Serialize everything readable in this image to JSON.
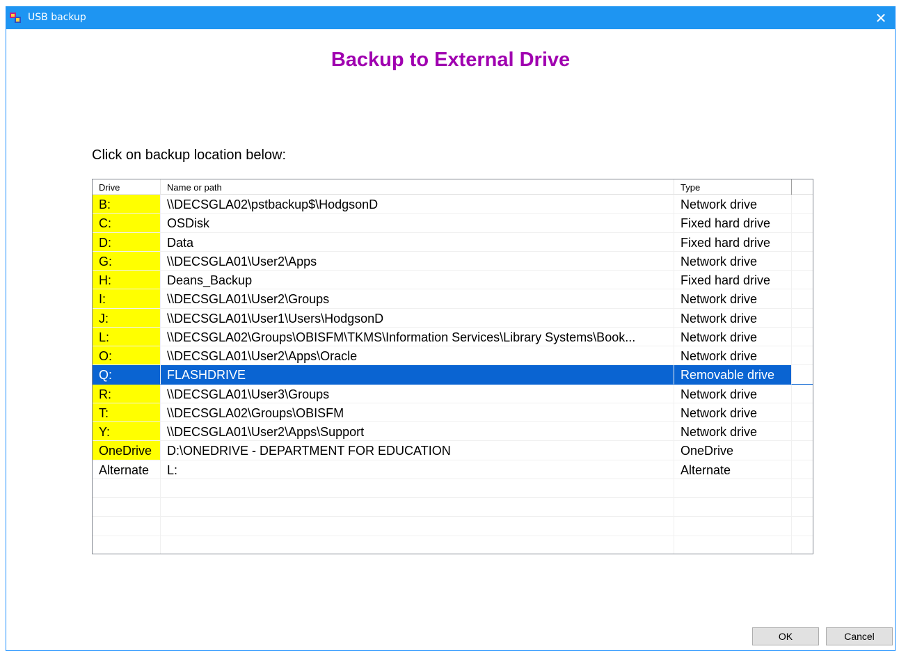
{
  "window": {
    "title": "USB backup",
    "close_glyph": "✕"
  },
  "heading": "Backup to External Drive",
  "prompt": "Click on backup location below:",
  "list": {
    "columns": [
      "Drive",
      "Name or path",
      "Type"
    ],
    "rows": [
      {
        "drive": "B:",
        "path": "\\\\DECSGLA02\\pstbackup$\\HodgsonD",
        "type": "Network drive"
      },
      {
        "drive": "C:",
        "path": "OSDisk",
        "type": "Fixed hard drive"
      },
      {
        "drive": "D:",
        "path": "Data",
        "type": "Fixed hard drive"
      },
      {
        "drive": "G:",
        "path": "\\\\DECSGLA01\\User2\\Apps",
        "type": "Network drive"
      },
      {
        "drive": "H:",
        "path": "Deans_Backup",
        "type": "Fixed hard drive"
      },
      {
        "drive": "I:",
        "path": "\\\\DECSGLA01\\User2\\Groups",
        "type": "Network drive"
      },
      {
        "drive": "J:",
        "path": "\\\\DECSGLA01\\User1\\Users\\HodgsonD",
        "type": "Network drive"
      },
      {
        "drive": "L:",
        "path": "\\\\DECSGLA02\\Groups\\OBISFM\\TKMS\\Information Services\\Library Systems\\Book...",
        "type": "Network drive"
      },
      {
        "drive": "O:",
        "path": "\\\\DECSGLA01\\User2\\Apps\\Oracle",
        "type": "Network drive"
      },
      {
        "drive": "Q:",
        "path": "FLASHDRIVE",
        "type": "Removable drive"
      },
      {
        "drive": "R:",
        "path": "\\\\DECSGLA01\\User3\\Groups",
        "type": "Network drive"
      },
      {
        "drive": "T:",
        "path": "\\\\DECSGLA02\\Groups\\OBISFM",
        "type": "Network drive"
      },
      {
        "drive": "Y:",
        "path": "\\\\DECSGLA01\\User2\\Apps\\Support",
        "type": "Network drive"
      },
      {
        "drive": "OneDrive",
        "path": "D:\\ONEDRIVE - DEPARTMENT FOR EDUCATION",
        "type": "OneDrive"
      },
      {
        "drive": "Alternate",
        "path": "L:",
        "type": "Alternate"
      }
    ],
    "selected_drive": "Q:",
    "highlight_color": "#ffff00",
    "selection_color": "#0a64d2"
  },
  "buttons": {
    "ok": "OK",
    "cancel": "Cancel"
  },
  "colors": {
    "titlebar": "#1e95f2",
    "heading": "#a000b0"
  }
}
